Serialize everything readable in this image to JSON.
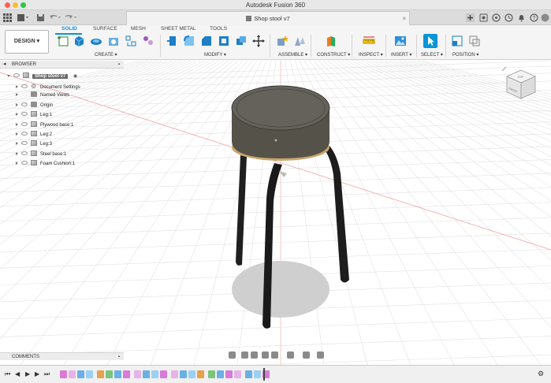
{
  "window": {
    "title": "Autodesk Fusion 360"
  },
  "document": {
    "tab_title": "Shop stool v7",
    "close_glyph": "×"
  },
  "workspace": {
    "button_label": "DESIGN ▾"
  },
  "ribbon": {
    "tabs": [
      {
        "label": "SOLID",
        "active": true
      },
      {
        "label": "SURFACE",
        "active": false
      },
      {
        "label": "MESH",
        "active": false
      },
      {
        "label": "SHEET METAL",
        "active": false
      },
      {
        "label": "TOOLS",
        "active": false
      }
    ],
    "groups": [
      {
        "label": "CREATE ▾"
      },
      {
        "label": "MODIFY ▾"
      },
      {
        "label": "ASSEMBLE ▾"
      },
      {
        "label": "CONSTRUCT ▾"
      },
      {
        "label": "INSPECT ▾"
      },
      {
        "label": "INSERT ▾"
      },
      {
        "label": "SELECT ▾"
      },
      {
        "label": "POSITION ▾"
      }
    ],
    "accent_color": "#0696d7"
  },
  "browser": {
    "header": "BROWSER",
    "root": "Shop stool v7",
    "items": [
      {
        "label": "Document Settings",
        "icon": "gear-icon"
      },
      {
        "label": "Named Views",
        "icon": "folder-icon"
      },
      {
        "label": "Origin",
        "icon": "folder-icon"
      },
      {
        "label": "Leg:1",
        "icon": "component-icon"
      },
      {
        "label": "Plywood base:1",
        "icon": "component-icon"
      },
      {
        "label": "Leg:2",
        "icon": "component-icon"
      },
      {
        "label": "Leg:3",
        "icon": "component-icon"
      },
      {
        "label": "Steel base:1",
        "icon": "component-icon"
      },
      {
        "label": "Foam Cushion:1",
        "icon": "component-icon"
      }
    ]
  },
  "comments": {
    "header": "COMMENTS"
  },
  "viewcube": {
    "face_label": "TOP",
    "front_label": "FRONT"
  },
  "timeline": {
    "controls": [
      "⏮",
      "◀",
      "▶",
      "▶",
      "⏭"
    ],
    "settings_glyph": "⚙"
  }
}
